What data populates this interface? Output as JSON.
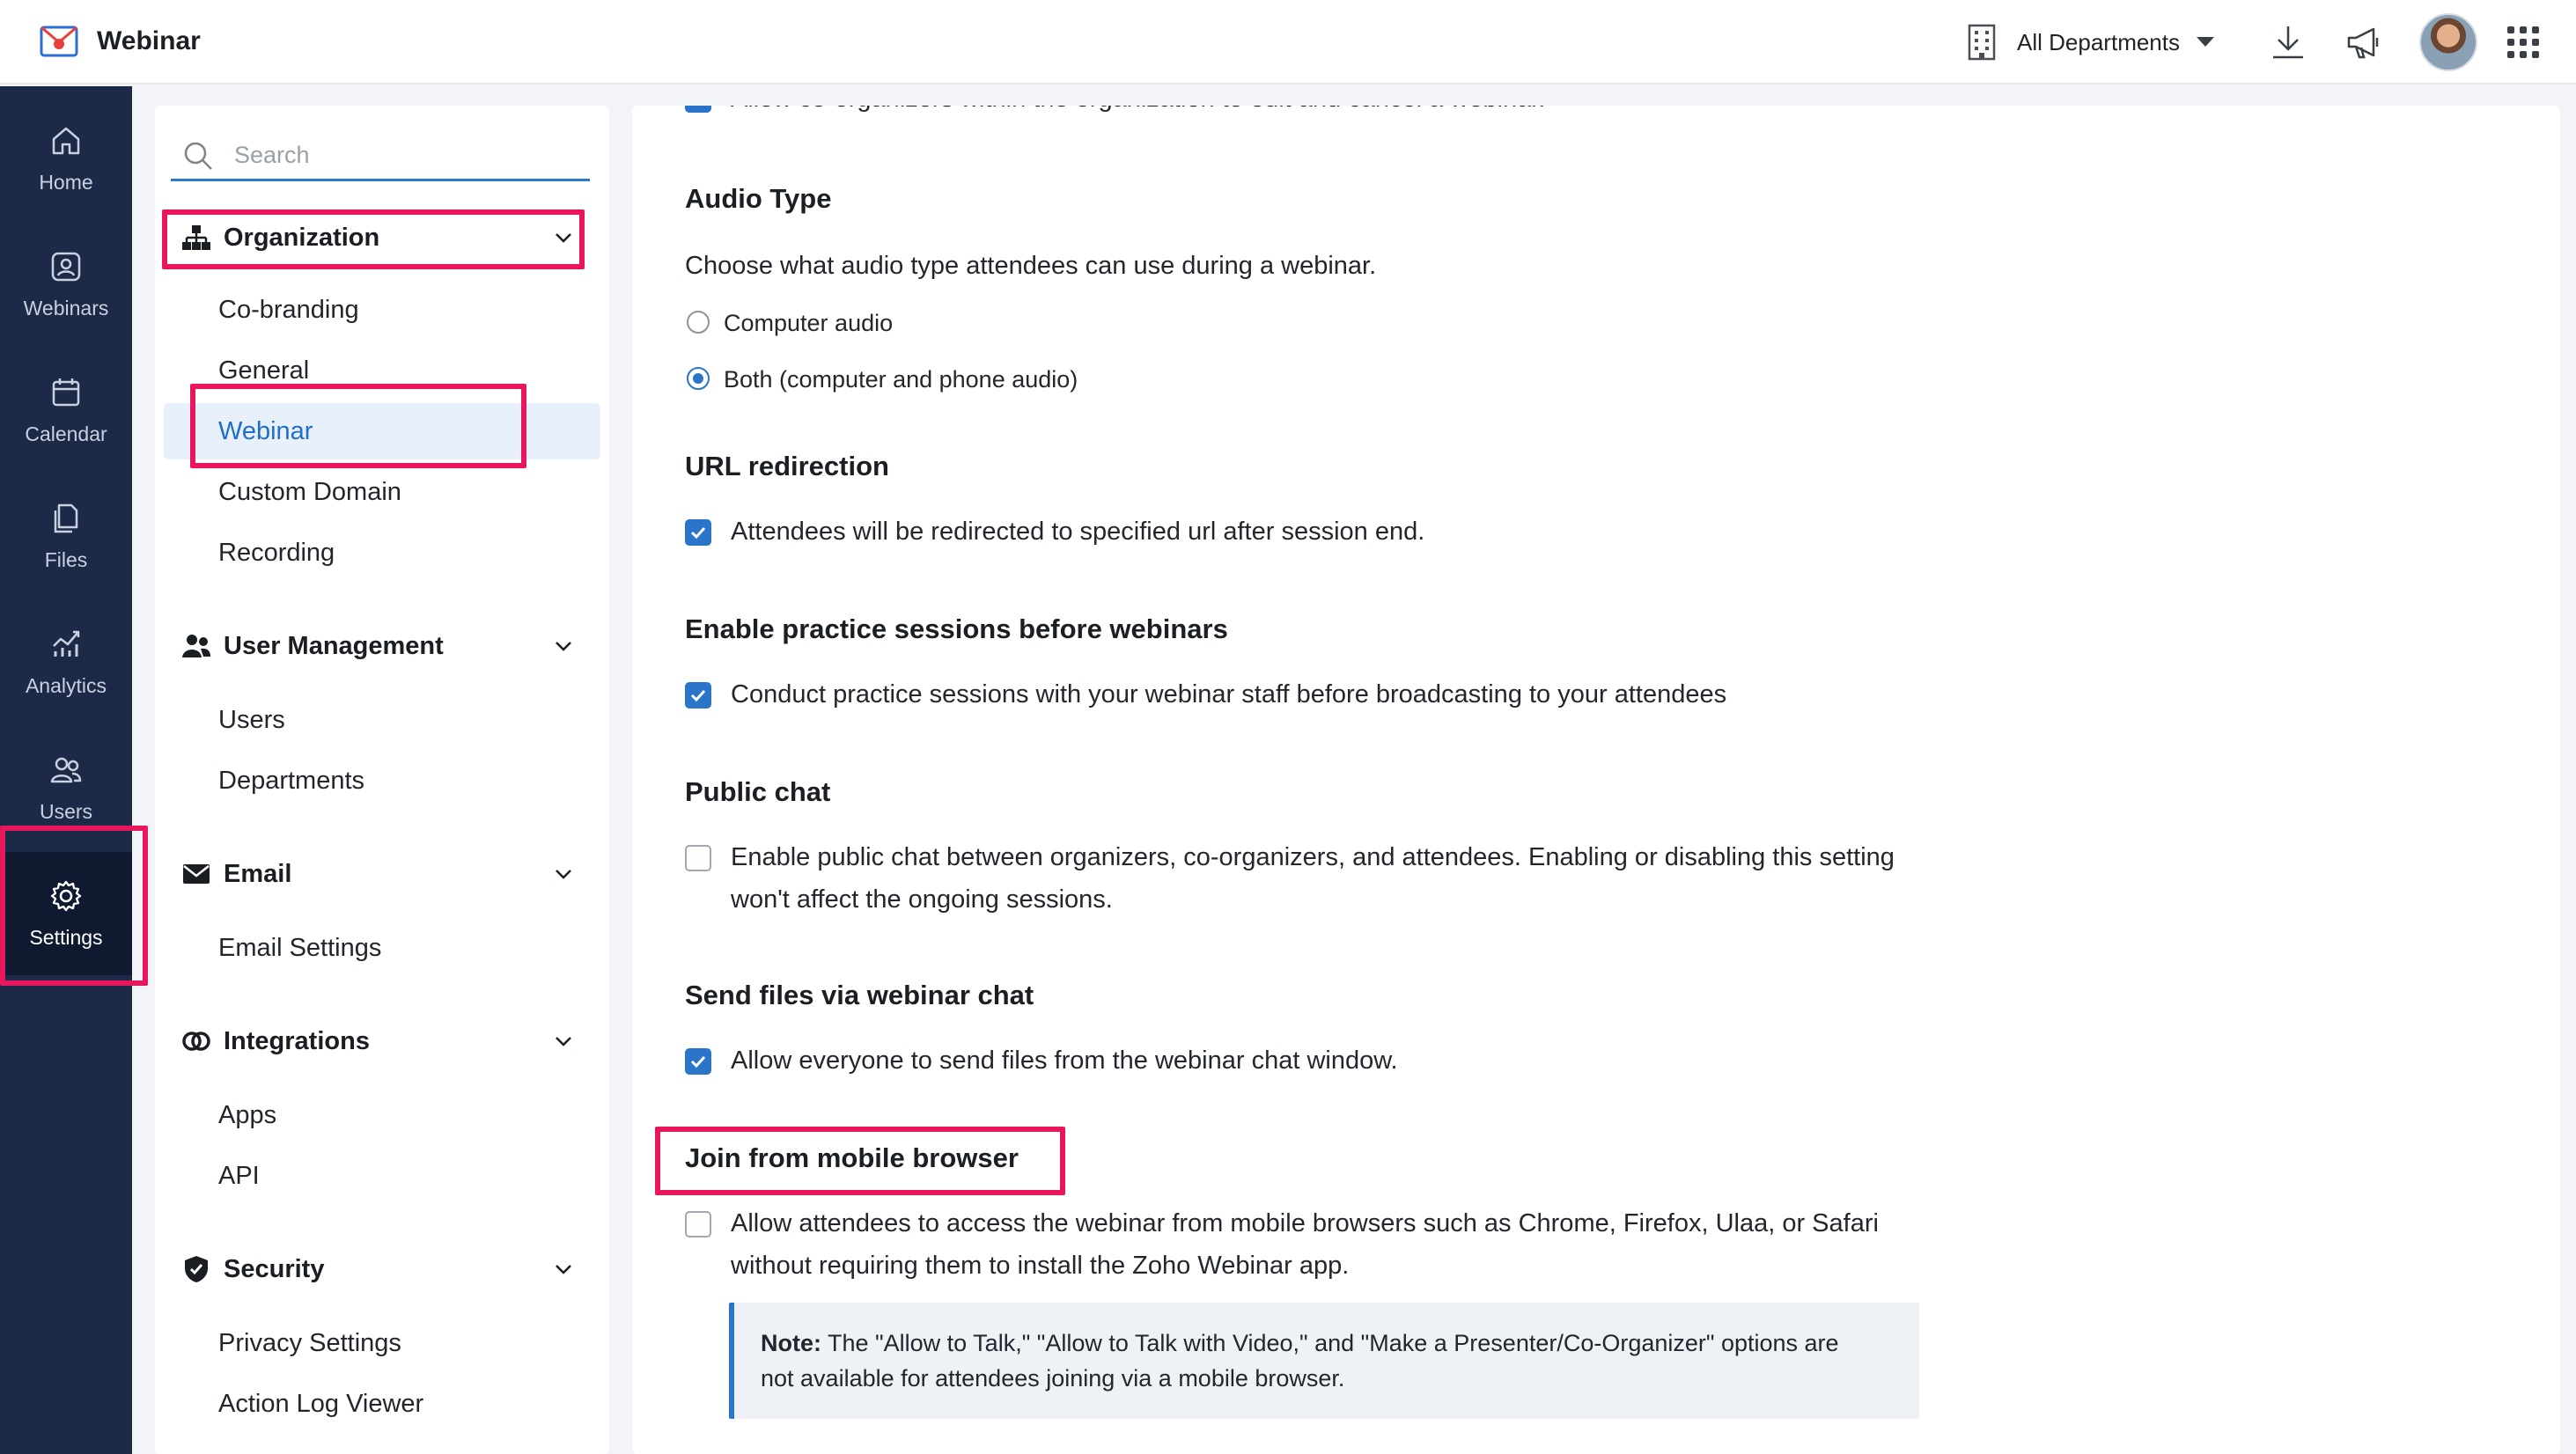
{
  "app": {
    "name": "Webinar",
    "department_selector": "All Departments"
  },
  "rail": {
    "items": [
      {
        "label": "Home",
        "icon": "home-icon"
      },
      {
        "label": "Webinars",
        "icon": "webinars-icon"
      },
      {
        "label": "Calendar",
        "icon": "calendar-icon"
      },
      {
        "label": "Files",
        "icon": "files-icon"
      },
      {
        "label": "Analytics",
        "icon": "analytics-icon"
      },
      {
        "label": "Users",
        "icon": "users-icon"
      },
      {
        "label": "Settings",
        "icon": "gear-icon",
        "active": true
      }
    ]
  },
  "nav": {
    "search_placeholder": "Search",
    "groups": [
      {
        "label": "Organization",
        "icon": "organization-icon",
        "items": [
          "Co-branding",
          "General",
          "Webinar",
          "Custom Domain",
          "Recording"
        ],
        "active_item": "Webinar"
      },
      {
        "label": "User Management",
        "icon": "user-management-icon",
        "items": [
          "Users",
          "Departments"
        ]
      },
      {
        "label": "Email",
        "icon": "email-icon",
        "items": [
          "Email Settings"
        ]
      },
      {
        "label": "Integrations",
        "icon": "integrations-icon",
        "items": [
          "Apps",
          "API"
        ]
      },
      {
        "label": "Security",
        "icon": "shield-icon",
        "items": [
          "Privacy Settings",
          "Action Log Viewer"
        ]
      }
    ]
  },
  "content": {
    "cut_off_top_option": "Allow co-organizers within the organization to edit and cancel a webinar.",
    "audio_type": {
      "title": "Audio Type",
      "description": "Choose what audio type attendees can use during a webinar.",
      "options": [
        {
          "label": "Computer audio",
          "selected": false
        },
        {
          "label": "Both (computer and phone audio)",
          "selected": true
        }
      ]
    },
    "url_redirection": {
      "title": "URL redirection",
      "option": "Attendees will be redirected to specified url after session end.",
      "checked": true
    },
    "practice_sessions": {
      "title": "Enable practice sessions before webinars",
      "option": "Conduct practice sessions with your webinar staff before broadcasting to your attendees",
      "checked": true
    },
    "public_chat": {
      "title": "Public chat",
      "option_line1": "Enable public chat between organizers, co-organizers, and attendees. Enabling or disabling this setting",
      "option_line2": "won't affect the ongoing sessions.",
      "checked": false
    },
    "send_files": {
      "title": "Send files via webinar chat",
      "option": "Allow everyone to send files from the webinar chat window.",
      "checked": true
    },
    "mobile_browser": {
      "title": "Join from mobile browser",
      "option_line1": "Allow attendees to access the webinar from mobile browsers such as Chrome, Firefox, Ulaa, or Safari",
      "option_line2": "without requiring them to install the Zoho Webinar app.",
      "checked": false,
      "note_label": "Note:",
      "note_line1": " The \"Allow to Talk,\" \"Allow to Talk with Video,\" and \"Make a Presenter/Co-Organizer\" options are",
      "note_line2": "not available for attendees joining via a mobile browser."
    }
  },
  "colors": {
    "accent": "#2a74c9",
    "rail_bg": "#1d2a47",
    "highlight": "#e8175d"
  }
}
